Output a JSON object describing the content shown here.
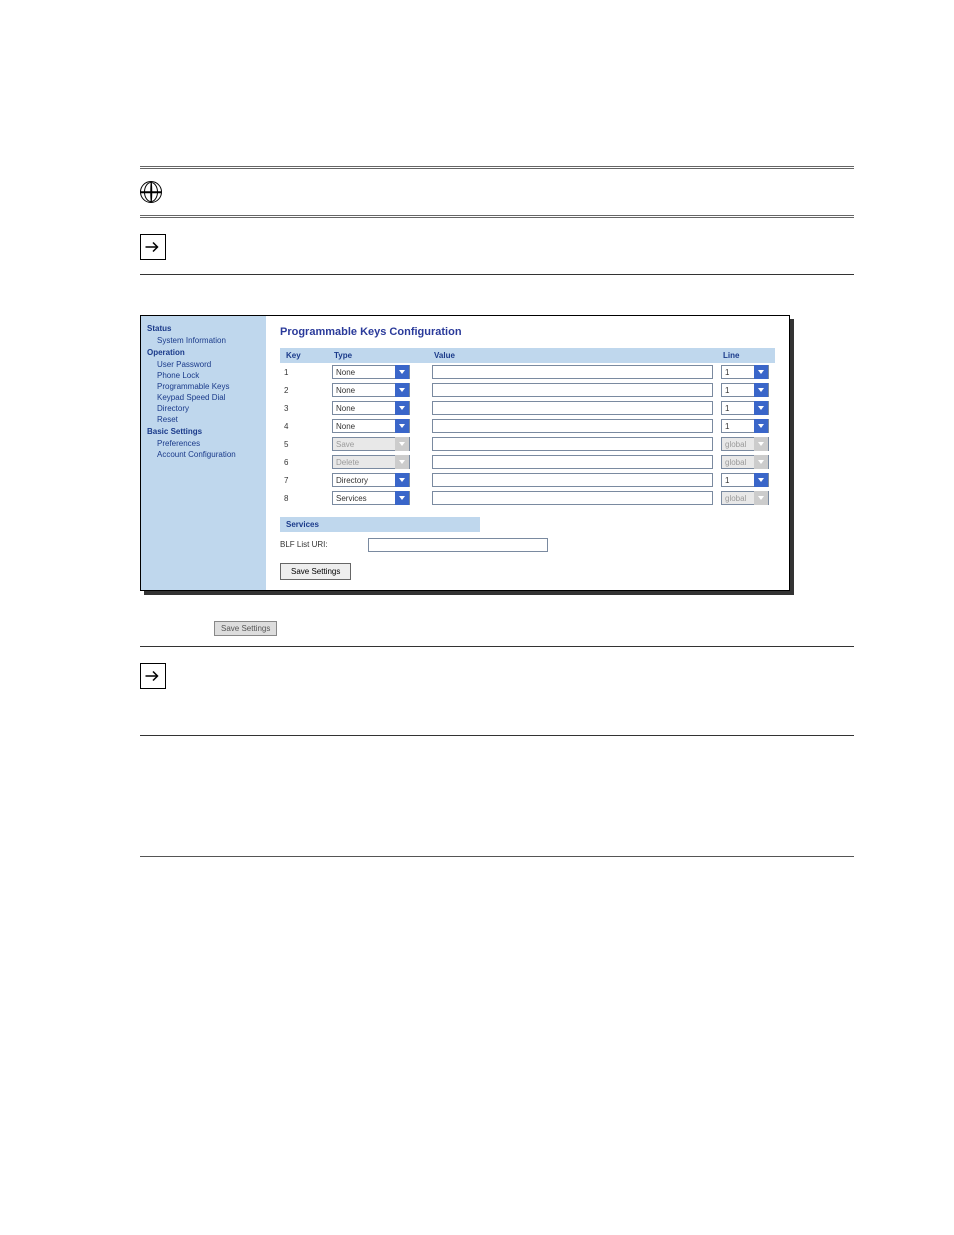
{
  "sidebar": {
    "sections": [
      {
        "header": "Status",
        "items": [
          "System Information"
        ]
      },
      {
        "header": "Operation",
        "items": [
          "User Password",
          "Phone Lock",
          "Programmable Keys",
          "Keypad Speed Dial",
          "Directory",
          "Reset"
        ]
      },
      {
        "header": "Basic Settings",
        "items": [
          "Preferences",
          "Account Configuration"
        ]
      }
    ]
  },
  "main": {
    "title": "Programmable Keys Configuration",
    "columns": {
      "key": "Key",
      "type": "Type",
      "value": "Value",
      "line": "Line"
    },
    "rows": [
      {
        "key": "1",
        "type": "None",
        "type_disabled": false,
        "value": "",
        "line": "1",
        "line_disabled": false
      },
      {
        "key": "2",
        "type": "None",
        "type_disabled": false,
        "value": "",
        "line": "1",
        "line_disabled": false
      },
      {
        "key": "3",
        "type": "None",
        "type_disabled": false,
        "value": "",
        "line": "1",
        "line_disabled": false
      },
      {
        "key": "4",
        "type": "None",
        "type_disabled": false,
        "value": "",
        "line": "1",
        "line_disabled": false
      },
      {
        "key": "5",
        "type": "Save",
        "type_disabled": true,
        "value": "",
        "line": "global",
        "line_disabled": true
      },
      {
        "key": "6",
        "type": "Delete",
        "type_disabled": true,
        "value": "",
        "line": "global",
        "line_disabled": true
      },
      {
        "key": "7",
        "type": "Directory",
        "type_disabled": false,
        "value": "",
        "line": "1",
        "line_disabled": false
      },
      {
        "key": "8",
        "type": "Services",
        "type_disabled": false,
        "value": "",
        "line": "global",
        "line_disabled": true
      }
    ],
    "services": {
      "header": "Services",
      "blf_label": "BLF List URI:",
      "blf_value": ""
    },
    "save_button": "Save Settings"
  },
  "inline_save_label": "Save Settings"
}
